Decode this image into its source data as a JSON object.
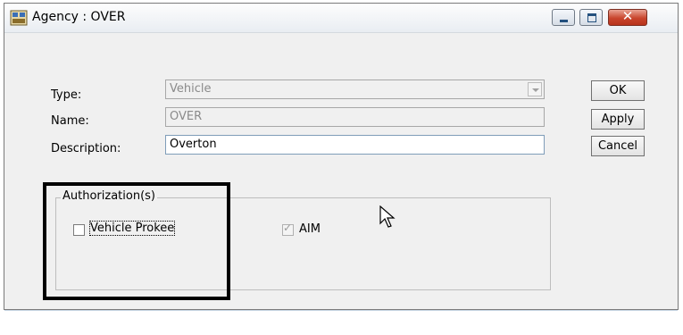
{
  "window": {
    "title": "Agency : OVER",
    "icon": "agency-app-icon",
    "controls": {
      "minimize": "minimize-icon",
      "maximize": "maximize-icon",
      "close": "close-icon",
      "close_glyph": "✕"
    }
  },
  "form": {
    "type_label": "Type:",
    "type_value": "Vehicle",
    "name_label": "Name:",
    "name_value": "OVER",
    "description_label": "Description:",
    "description_value": "Overton"
  },
  "buttons": {
    "ok": "OK",
    "apply": "Apply",
    "cancel": "Cancel"
  },
  "authorizations": {
    "group_title": "Authorization(s)",
    "items": [
      {
        "label": "Vehicle Prokee",
        "checked": false,
        "enabled": true,
        "focused": true
      },
      {
        "label": "AIM",
        "checked": true,
        "enabled": false,
        "focused": false
      }
    ]
  },
  "colors": {
    "window_bg": "#f0f0f0",
    "highlight_border": "#000000",
    "close_button": "#c8452d"
  }
}
